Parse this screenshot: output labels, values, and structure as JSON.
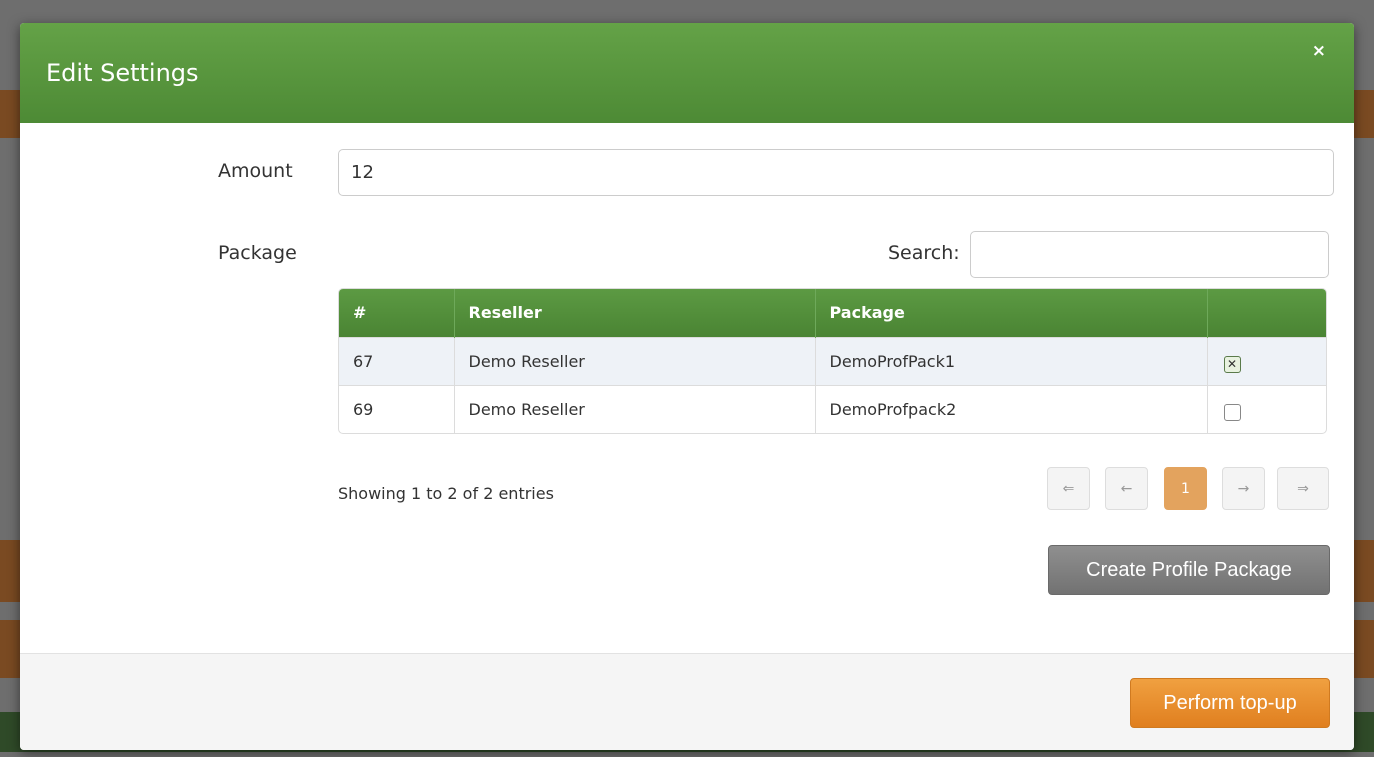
{
  "modal": {
    "title": "Edit Settings",
    "close_label": "×"
  },
  "form": {
    "amount_label": "Amount",
    "amount_value": "12",
    "package_label": "Package",
    "search_label": "Search:",
    "search_value": ""
  },
  "table": {
    "columns": [
      "#",
      "Reseller",
      "Package",
      ""
    ],
    "rows": [
      {
        "id": "67",
        "reseller": "Demo Reseller",
        "package": "DemoProfPack1",
        "selected": true
      },
      {
        "id": "69",
        "reseller": "Demo Reseller",
        "package": "DemoProfpack2",
        "selected": false
      }
    ]
  },
  "pagination": {
    "info": "Showing 1 to 2 of 2 entries",
    "first": "⇐",
    "prev": "←",
    "current": "1",
    "next": "→",
    "last": "⇒"
  },
  "buttons": {
    "create_package": "Create Profile Package",
    "perform_topup": "Perform top-up"
  },
  "colors": {
    "header_green": "#5a9a40",
    "accent_orange": "#e8902c",
    "grey_button": "#808080"
  }
}
